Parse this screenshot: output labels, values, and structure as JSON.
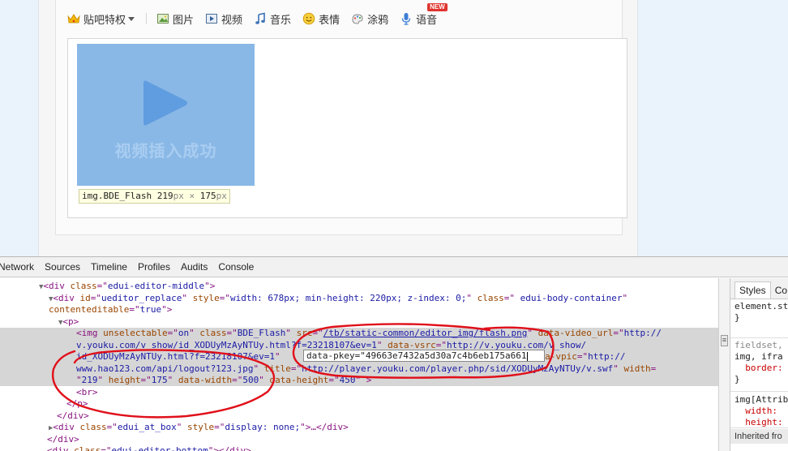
{
  "toolbar": {
    "items": [
      {
        "label": "贴吧特权",
        "icon": "crown-icon"
      },
      {
        "label": "图片",
        "icon": "image-icon"
      },
      {
        "label": "视频",
        "icon": "video-icon"
      },
      {
        "label": "音乐",
        "icon": "music-note-icon"
      },
      {
        "label": "表情",
        "icon": "smiley-icon"
      },
      {
        "label": "涂鸦",
        "icon": "paint-icon"
      },
      {
        "label": "语音",
        "icon": "microphone-icon"
      }
    ],
    "new_badge": "NEW"
  },
  "editor": {
    "video_caption": "视频插入成功",
    "tooltip": {
      "tag": "img.BDE_Flash",
      "width": "219",
      "height": "175",
      "unit": "px",
      "times": "×"
    }
  },
  "devtools": {
    "tabs": [
      "Network",
      "Sources",
      "Timeline",
      "Profiles",
      "Audits",
      "Console"
    ],
    "edit_field_value": "data-pkey=\"49663e7432a5d30a7c4b6eb175a661",
    "side_tabs": [
      "Styles",
      "Co"
    ],
    "inherited_label": "Inherited fro",
    "colors": {
      "annotation": "#e0101a",
      "selected_row": "#d6d6d6",
      "tag": "#881280",
      "attr_name": "#994500",
      "attr_value": "#1a1aa6"
    }
  }
}
